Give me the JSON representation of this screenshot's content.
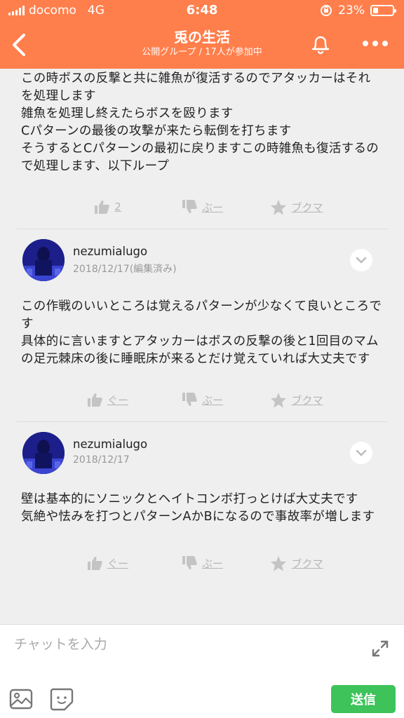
{
  "status_bar": {
    "carrier": "docomo",
    "network": "4G",
    "time": "6:48",
    "battery": "23%"
  },
  "header": {
    "title": "兎の生活",
    "subtitle": "公開グループ / 17人が参加中",
    "accent_color": "#ff7f4c"
  },
  "posts": [
    {
      "text": "この時ボスの反撃と共に雑魚が復活するのでアタッカーはそれを処理します\n雑魚を処理し終えたらボスを殴ります\nCパターンの最後の攻撃が来たら転倒を打ちます\nそうするとCパターンの最初に戻りますこの時雑魚も復活するので処理します、以下ループ",
      "like_label": "2",
      "dislike_label": "ぶー",
      "bookmark_label": "ブクマ"
    },
    {
      "username": "nezumialugo",
      "date": "2018/12/17(編集済み)",
      "text": "この作戦のいいところは覚えるパターンが少なくて良いところです\n具体的に言いますとアタッカーはボスの反撃の後と1回目のマムの足元棘床の後に睡眠床が来るとだけ覚えていれば大丈夫です",
      "like_label": "ぐー",
      "dislike_label": "ぶー",
      "bookmark_label": "ブクマ"
    },
    {
      "username": "nezumialugo",
      "date": "2018/12/17",
      "text": "壁は基本的にソニックとヘイトコンボ打っとけば大丈夫です\n気絶や怯みを打つとパターンAかBになるので事故率が増します",
      "like_label": "ぐー",
      "dislike_label": "ぶー",
      "bookmark_label": "ブクマ"
    }
  ],
  "composer": {
    "placeholder": "チャットを入力",
    "send_label": "送信",
    "send_color": "#3dc35a"
  }
}
